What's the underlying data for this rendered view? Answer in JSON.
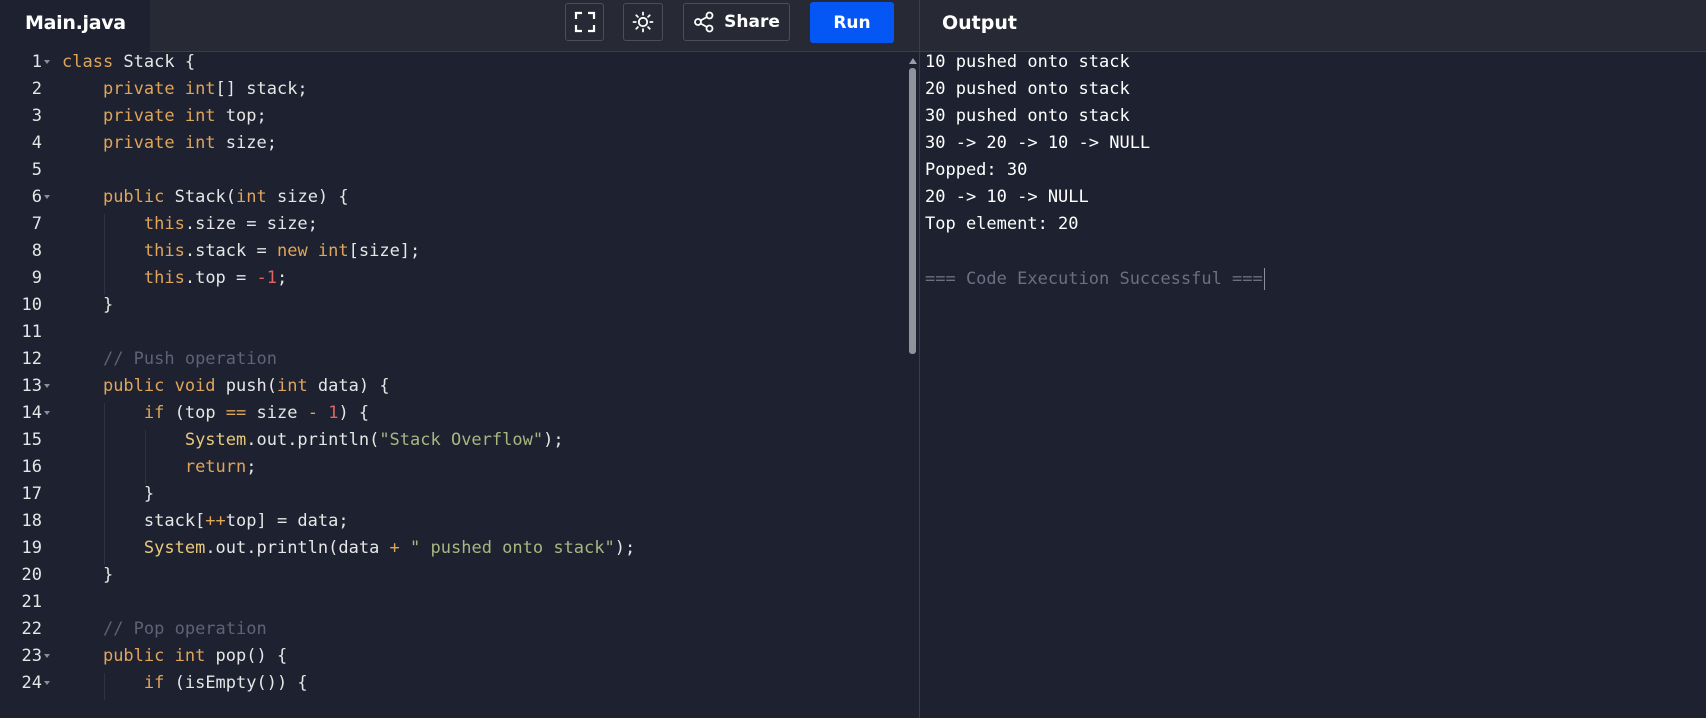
{
  "editor": {
    "file_tab": "Main.java",
    "lines": [
      {
        "n": "1",
        "fold": true,
        "tokens": [
          [
            "kw",
            "class "
          ],
          [
            "",
            "Stack {"
          ]
        ]
      },
      {
        "n": "2",
        "fold": false,
        "tokens": [
          [
            "",
            "    "
          ],
          [
            "kw",
            "private int"
          ],
          [
            "",
            "[] stack;"
          ]
        ]
      },
      {
        "n": "3",
        "fold": false,
        "tokens": [
          [
            "",
            "    "
          ],
          [
            "kw",
            "private int"
          ],
          [
            "",
            " top;"
          ]
        ]
      },
      {
        "n": "4",
        "fold": false,
        "tokens": [
          [
            "",
            "    "
          ],
          [
            "kw",
            "private int"
          ],
          [
            "",
            " size;"
          ]
        ]
      },
      {
        "n": "5",
        "fold": false,
        "tokens": []
      },
      {
        "n": "6",
        "fold": true,
        "tokens": [
          [
            "",
            "    "
          ],
          [
            "kw",
            "public"
          ],
          [
            "",
            " Stack("
          ],
          [
            "kw",
            "int"
          ],
          [
            "",
            " size) {"
          ]
        ]
      },
      {
        "n": "7",
        "fold": false,
        "tokens": [
          [
            "",
            "        "
          ],
          [
            "kw",
            "this"
          ],
          [
            "",
            ".size = size;"
          ]
        ]
      },
      {
        "n": "8",
        "fold": false,
        "tokens": [
          [
            "",
            "        "
          ],
          [
            "kw",
            "this"
          ],
          [
            "",
            ".stack = "
          ],
          [
            "kw",
            "new int"
          ],
          [
            "",
            "[size];"
          ]
        ]
      },
      {
        "n": "9",
        "fold": false,
        "tokens": [
          [
            "",
            "        "
          ],
          [
            "kw",
            "this"
          ],
          [
            "",
            ".top = "
          ],
          [
            "num",
            "-1"
          ],
          [
            "",
            ";"
          ]
        ]
      },
      {
        "n": "10",
        "fold": false,
        "tokens": [
          [
            "",
            "    }"
          ]
        ]
      },
      {
        "n": "11",
        "fold": false,
        "tokens": []
      },
      {
        "n": "12",
        "fold": false,
        "tokens": [
          [
            "",
            "    "
          ],
          [
            "cm",
            "// Push operation"
          ]
        ]
      },
      {
        "n": "13",
        "fold": true,
        "tokens": [
          [
            "",
            "    "
          ],
          [
            "kw",
            "public void"
          ],
          [
            "",
            " push("
          ],
          [
            "kw",
            "int"
          ],
          [
            "",
            " data) {"
          ]
        ]
      },
      {
        "n": "14",
        "fold": true,
        "tokens": [
          [
            "",
            "        "
          ],
          [
            "kw",
            "if"
          ],
          [
            "",
            " (top "
          ],
          [
            "kw",
            "=="
          ],
          [
            "",
            " size "
          ],
          [
            "kw",
            "-"
          ],
          [
            "",
            " "
          ],
          [
            "num",
            "1"
          ],
          [
            "",
            ") {"
          ]
        ]
      },
      {
        "n": "15",
        "fold": false,
        "tokens": [
          [
            "",
            "            "
          ],
          [
            "cls",
            "System"
          ],
          [
            "",
            ".out.println("
          ],
          [
            "str",
            "\"Stack Overflow\""
          ],
          [
            "",
            ");"
          ]
        ]
      },
      {
        "n": "16",
        "fold": false,
        "tokens": [
          [
            "",
            "            "
          ],
          [
            "kw",
            "return"
          ],
          [
            "",
            ";"
          ]
        ]
      },
      {
        "n": "17",
        "fold": false,
        "tokens": [
          [
            "",
            "        }"
          ]
        ]
      },
      {
        "n": "18",
        "fold": false,
        "tokens": [
          [
            "",
            "        stack["
          ],
          [
            "kw",
            "++"
          ],
          [
            "",
            "top] = data;"
          ]
        ]
      },
      {
        "n": "19",
        "fold": false,
        "tokens": [
          [
            "",
            "        "
          ],
          [
            "cls",
            "System"
          ],
          [
            "",
            ".out.println(data "
          ],
          [
            "kw",
            "+"
          ],
          [
            "",
            " "
          ],
          [
            "str",
            "\" pushed onto stack\""
          ],
          [
            "",
            ");"
          ]
        ]
      },
      {
        "n": "20",
        "fold": false,
        "tokens": [
          [
            "",
            "    }"
          ]
        ]
      },
      {
        "n": "21",
        "fold": false,
        "tokens": []
      },
      {
        "n": "22",
        "fold": false,
        "tokens": [
          [
            "",
            "    "
          ],
          [
            "cm",
            "// Pop operation"
          ]
        ]
      },
      {
        "n": "23",
        "fold": true,
        "tokens": [
          [
            "",
            "    "
          ],
          [
            "kw",
            "public int"
          ],
          [
            "",
            " pop() {"
          ]
        ]
      },
      {
        "n": "24",
        "fold": true,
        "tokens": [
          [
            "",
            "        "
          ],
          [
            "kw",
            "if"
          ],
          [
            "",
            " (isEmpty()) {"
          ]
        ]
      }
    ]
  },
  "toolbar": {
    "fullscreen_icon": "fullscreen-icon",
    "theme_icon": "sun-icon",
    "share_label": "Share",
    "run_label": "Run"
  },
  "output": {
    "title": "Output",
    "lines": [
      "10 pushed onto stack",
      "20 pushed onto stack",
      "30 pushed onto stack",
      "30 -> 20 -> 10 -> NULL",
      "Popped: 30",
      "20 -> 10 -> NULL",
      "Top element: 20",
      "",
      "=== Code Execution Successful ==="
    ]
  },
  "colors": {
    "accent": "#0557f5",
    "background": "#1d2130",
    "keyword": "#e0a55a",
    "string": "#a8b681",
    "number": "#e0655e",
    "comment": "#5d6475"
  }
}
